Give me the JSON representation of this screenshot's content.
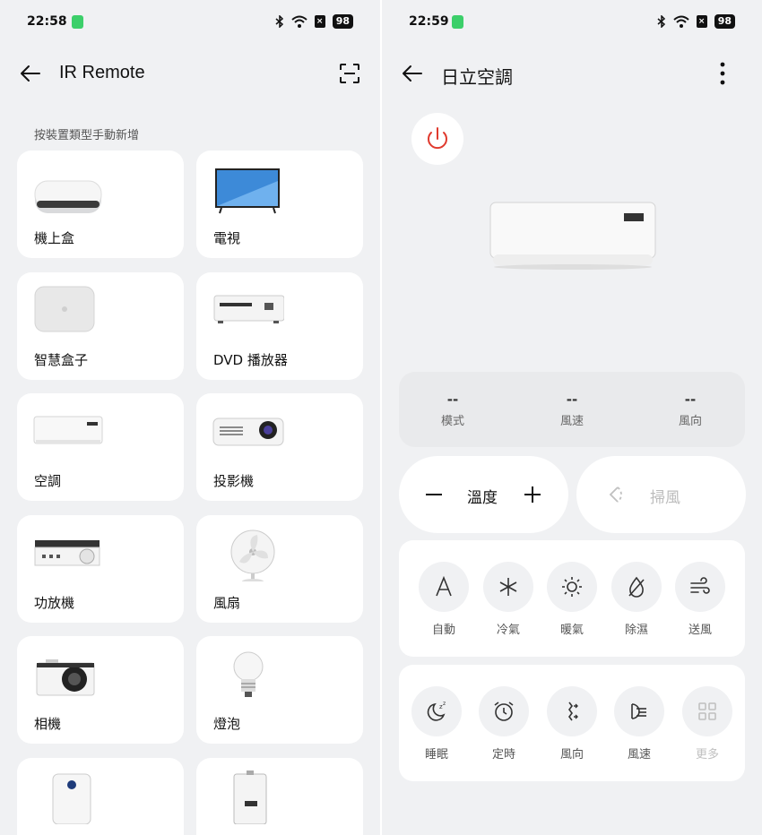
{
  "left": {
    "status": {
      "time": "22:58",
      "battery": "98"
    },
    "title": "IR Remote",
    "section_label": "按裝置類型手動新增",
    "devices": [
      {
        "label": "機上盒"
      },
      {
        "label": "電視"
      },
      {
        "label": "智慧盒子"
      },
      {
        "label": "DVD 播放器"
      },
      {
        "label": "空調"
      },
      {
        "label": "投影機"
      },
      {
        "label": "功放機"
      },
      {
        "label": "風扇"
      },
      {
        "label": "相機"
      },
      {
        "label": "燈泡"
      },
      {
        "label": ""
      },
      {
        "label": ""
      }
    ]
  },
  "right": {
    "status": {
      "time": "22:59",
      "battery": "98"
    },
    "title": "日立空調",
    "info": [
      {
        "value": "--",
        "label": "模式"
      },
      {
        "value": "--",
        "label": "風速"
      },
      {
        "value": "--",
        "label": "風向"
      }
    ],
    "temp_label": "溫度",
    "swing_label": "掃風",
    "modes": [
      {
        "label": "自動",
        "icon": "auto-icon"
      },
      {
        "label": "冷氣",
        "icon": "snowflake-icon"
      },
      {
        "label": "暖氣",
        "icon": "sun-icon"
      },
      {
        "label": "除濕",
        "icon": "dehumidify-icon"
      },
      {
        "label": "送風",
        "icon": "wind-icon"
      }
    ],
    "functions": [
      {
        "label": "睡眠",
        "icon": "sleep-icon"
      },
      {
        "label": "定時",
        "icon": "alarm-icon"
      },
      {
        "label": "風向",
        "icon": "direction-icon"
      },
      {
        "label": "風速",
        "icon": "fan-speed-icon"
      },
      {
        "label": "更多",
        "icon": "grid-icon"
      }
    ],
    "colors": {
      "power": "#e03a2e",
      "disabled": "#b8b8b8"
    }
  }
}
